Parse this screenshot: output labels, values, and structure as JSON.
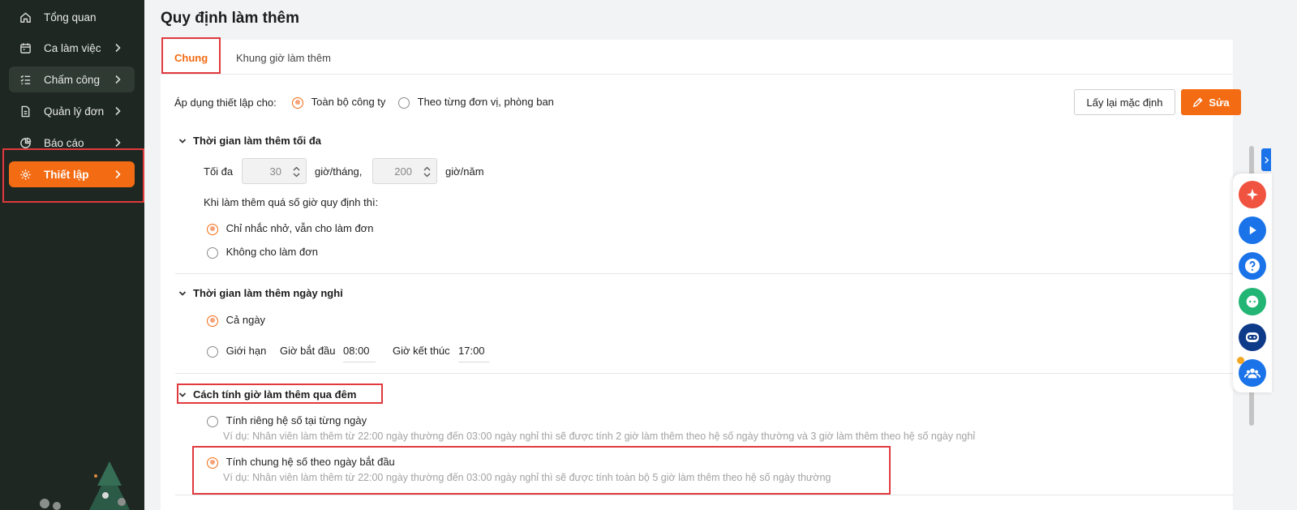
{
  "sidebar": {
    "items": [
      {
        "label": "Tổng quan",
        "icon": "home-icon"
      },
      {
        "label": "Ca làm việc",
        "icon": "calendar-icon"
      },
      {
        "label": "Chấm công",
        "icon": "checklist-icon"
      },
      {
        "label": "Quản lý đơn",
        "icon": "document-icon"
      },
      {
        "label": "Báo cáo",
        "icon": "pie-chart-icon"
      },
      {
        "label": "Thiết lập",
        "icon": "gear-icon"
      }
    ]
  },
  "page": {
    "title": "Quy định làm thêm"
  },
  "tabs": [
    {
      "label": "Chung",
      "active": true
    },
    {
      "label": "Khung giờ làm thêm",
      "active": false
    }
  ],
  "apply": {
    "label": "Áp dụng thiết lập cho:",
    "options": [
      "Toàn bộ công ty",
      "Theo từng đơn vị, phòng ban"
    ],
    "selected": 0
  },
  "buttons": {
    "reset": "Lấy lại mặc định",
    "edit": "Sửa"
  },
  "max_ot": {
    "title": "Thời gian làm thêm tối đa",
    "prefix": "Tối đa",
    "month_value": "30",
    "month_unit": "giờ/tháng,",
    "year_value": "200",
    "year_unit": "giờ/năm",
    "exceed_label": "Khi làm thêm quá số giờ quy định thì:",
    "options": [
      "Chỉ nhắc nhở, vẫn cho làm đơn",
      "Không cho làm đơn"
    ],
    "selected": 0
  },
  "holiday_ot": {
    "title": "Thời gian làm thêm ngày nghỉ",
    "opt_all": "Cả ngày",
    "opt_limit": "Giới hạn",
    "start_label": "Giờ bắt đầu",
    "start_value": "08:00",
    "end_label": "Giờ kết thúc",
    "end_value": "17:00",
    "selected": 0
  },
  "overnight": {
    "title": "Cách tính giờ làm thêm qua đêm",
    "options": [
      {
        "label": "Tính riêng hệ số tại từng ngày",
        "hint": "Ví dụ: Nhân viên làm thêm từ 22:00 ngày thường đến 03:00 ngày nghỉ thì sẽ được tính 2 giờ làm thêm theo hệ số ngày thường và 3 giờ làm thêm theo hệ số ngày nghỉ"
      },
      {
        "label": "Tính chung hệ số theo ngày bắt đầu",
        "hint": "Ví dụ: Nhân viên làm thêm từ 22:00 ngày thường đến 03:00 ngày nghỉ thì sẽ được tính toàn bộ 5 giờ làm thêm theo hệ số ngày thường"
      }
    ],
    "selected": 1
  },
  "colors": {
    "accent": "#f36b13",
    "sidebar_bg": "#1e2721",
    "highlight": "#e0393e"
  }
}
